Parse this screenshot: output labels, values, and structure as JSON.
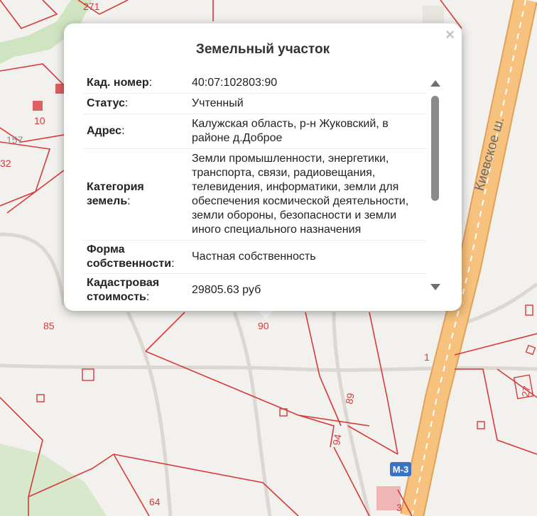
{
  "popup": {
    "title": "Земельный участок",
    "close_label": "×",
    "rows": [
      {
        "key": "Кад. номер",
        "value": "40:07:102803:90"
      },
      {
        "key": "Статус",
        "value": "Учтенный"
      },
      {
        "key": "Адрес",
        "value": "Калужская область, р-н Жуковский, в районе д.Доброе"
      },
      {
        "key": "Категория земель",
        "value": "Земли промышленности, энергетики, транспорта, связи, радиовещания, телевидения, информатики, земли для обеспечения космической деятельности, земли обороны, безопасности и земли иного специального назначения"
      },
      {
        "key": "Форма собственности",
        "value": "Частная собственность"
      },
      {
        "key": "Кадастровая стоимость",
        "value": "29805.63 руб"
      }
    ]
  },
  "map": {
    "parcel_labels": [
      "271",
      "10",
      "157",
      "32",
      "85",
      "90",
      "89",
      "94",
      "1",
      "27",
      "64",
      "3"
    ],
    "road_name": "Киевское ш.",
    "highway_badge": "М-3",
    "colors": {
      "background": "#f3f1ee",
      "parcel_line": "#d63a3a",
      "highway": "#f6c27d",
      "greenery": "#cfe5c2",
      "badge": "#3a73c2"
    }
  }
}
